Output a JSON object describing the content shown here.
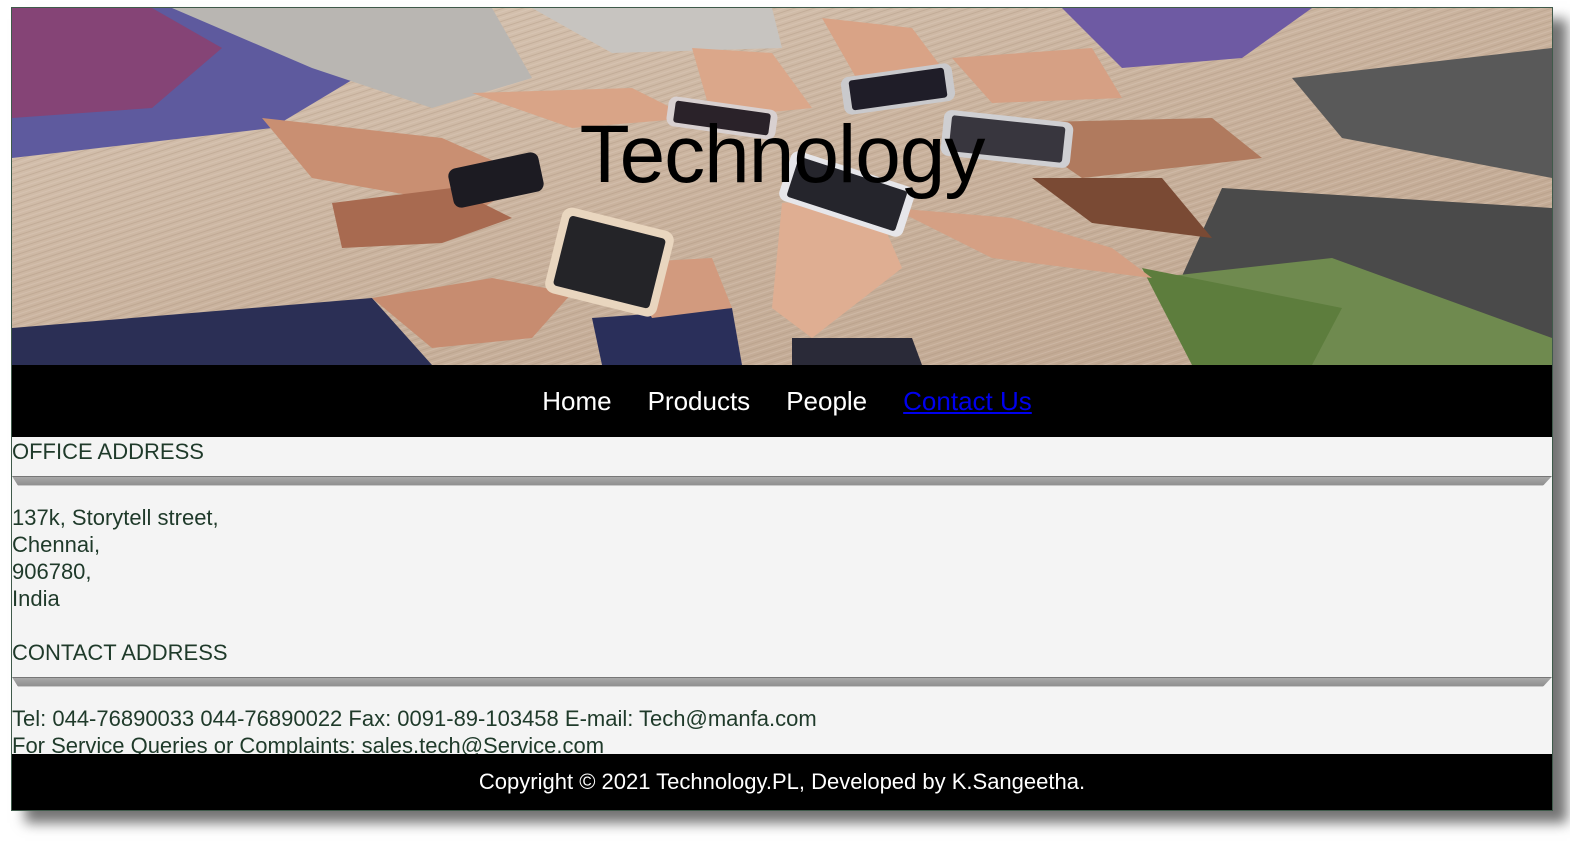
{
  "hero": {
    "title": "Technology",
    "image_icon": "hands-with-smartphones-photo"
  },
  "nav": {
    "items": [
      {
        "label": "Home",
        "active": false
      },
      {
        "label": "Products",
        "active": false
      },
      {
        "label": "People",
        "active": false
      },
      {
        "label": "Contact Us",
        "active": true
      }
    ]
  },
  "office": {
    "heading": "OFFICE ADDRESS",
    "lines": [
      "137k, Storytell street,",
      "Chennai,",
      "906780,",
      "India"
    ]
  },
  "contact": {
    "heading": "CONTACT ADDRESS",
    "line1": "Tel: 044-76890033 044-76890022 Fax: 0091-89-103458 E-mail: Tech@manfa.com",
    "line2": "For Service Queries or Complaints: sales.tech@Service.com"
  },
  "footer": {
    "copyright": "Copyright © 2021 Technology.PL, Developed by K.Sangeetha."
  },
  "colors": {
    "nav_bg": "#000000",
    "nav_text": "#ffffff",
    "active_link": "#0000ee",
    "body_text": "#1f3a2a",
    "content_bg": "#f4f4f4"
  }
}
